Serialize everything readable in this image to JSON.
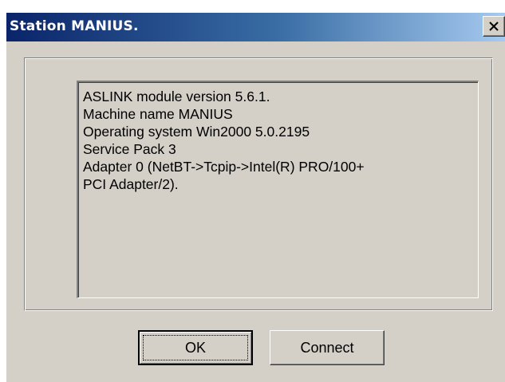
{
  "window": {
    "title": "Station MANIUS.",
    "close_label": "X"
  },
  "info": {
    "lines": [
      "ASLINK module version 5.6.1.",
      "Machine name MANIUS",
      "Operating system Win2000 5.0.2195",
      "Service Pack 3",
      "Adapter 0 (NetBT->Tcpip->Intel(R) PRO/100+",
      "PCI Adapter/2)."
    ]
  },
  "buttons": {
    "ok_label": "OK",
    "connect_label": "Connect"
  },
  "colors": {
    "dialog_face": "#d4d0c8",
    "titlebar_start": "#0a246a",
    "titlebar_end": "#a6caf0",
    "title_text": "#ffffff"
  },
  "icons": {
    "close": "close-icon"
  }
}
